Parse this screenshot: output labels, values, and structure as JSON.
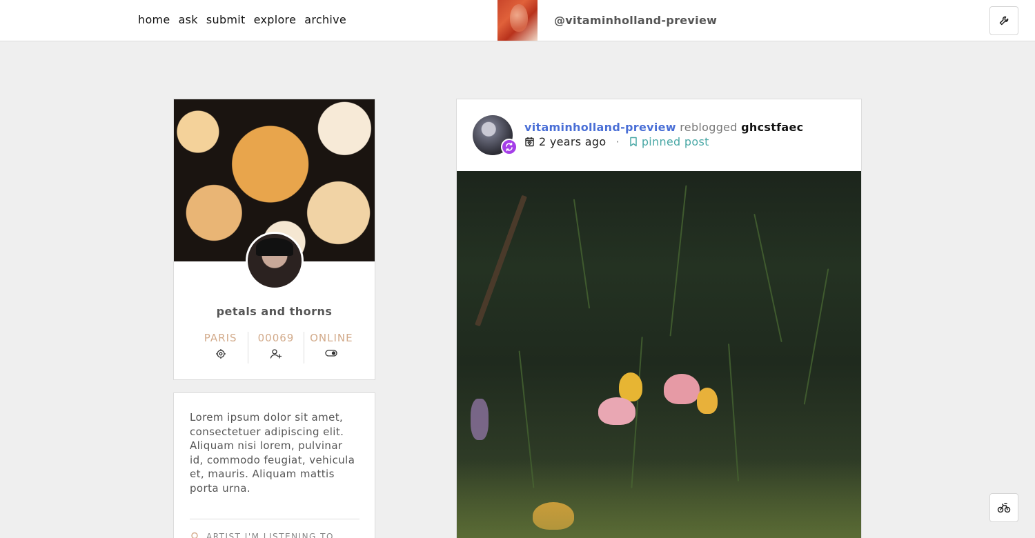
{
  "nav": {
    "links": [
      "home",
      "ask",
      "submit",
      "explore",
      "archive"
    ]
  },
  "header": {
    "handle": "@vitaminholland-preview"
  },
  "profile": {
    "name": "petals and thorns",
    "stats": [
      {
        "label": "PARIS",
        "icon": "location-target-icon"
      },
      {
        "label": "00069",
        "icon": "add-user-icon"
      },
      {
        "label": "ONLINE",
        "icon": "toggle-icon"
      }
    ]
  },
  "description": {
    "text": "Lorem ipsum dolor sit amet, consectetuer adipiscing elit. Aliquam nisi lorem, pulvinar id, commodo feugiat, vehicula et, mauris. Aliquam mattis porta urna.",
    "listening_label": "ARTIST I'M LISTENING TO"
  },
  "post": {
    "username": "vitaminholland-preview",
    "action": "reblogged",
    "source": "ghcstfaec",
    "time": "2 years ago",
    "separator": "·",
    "pinned": "pinned post"
  },
  "colors": {
    "link_blue": "#4a6fd6",
    "pinned_teal": "#4aa8a6",
    "stat_tan": "#d2aa8a",
    "reblog_purple": "#a53ee8"
  }
}
